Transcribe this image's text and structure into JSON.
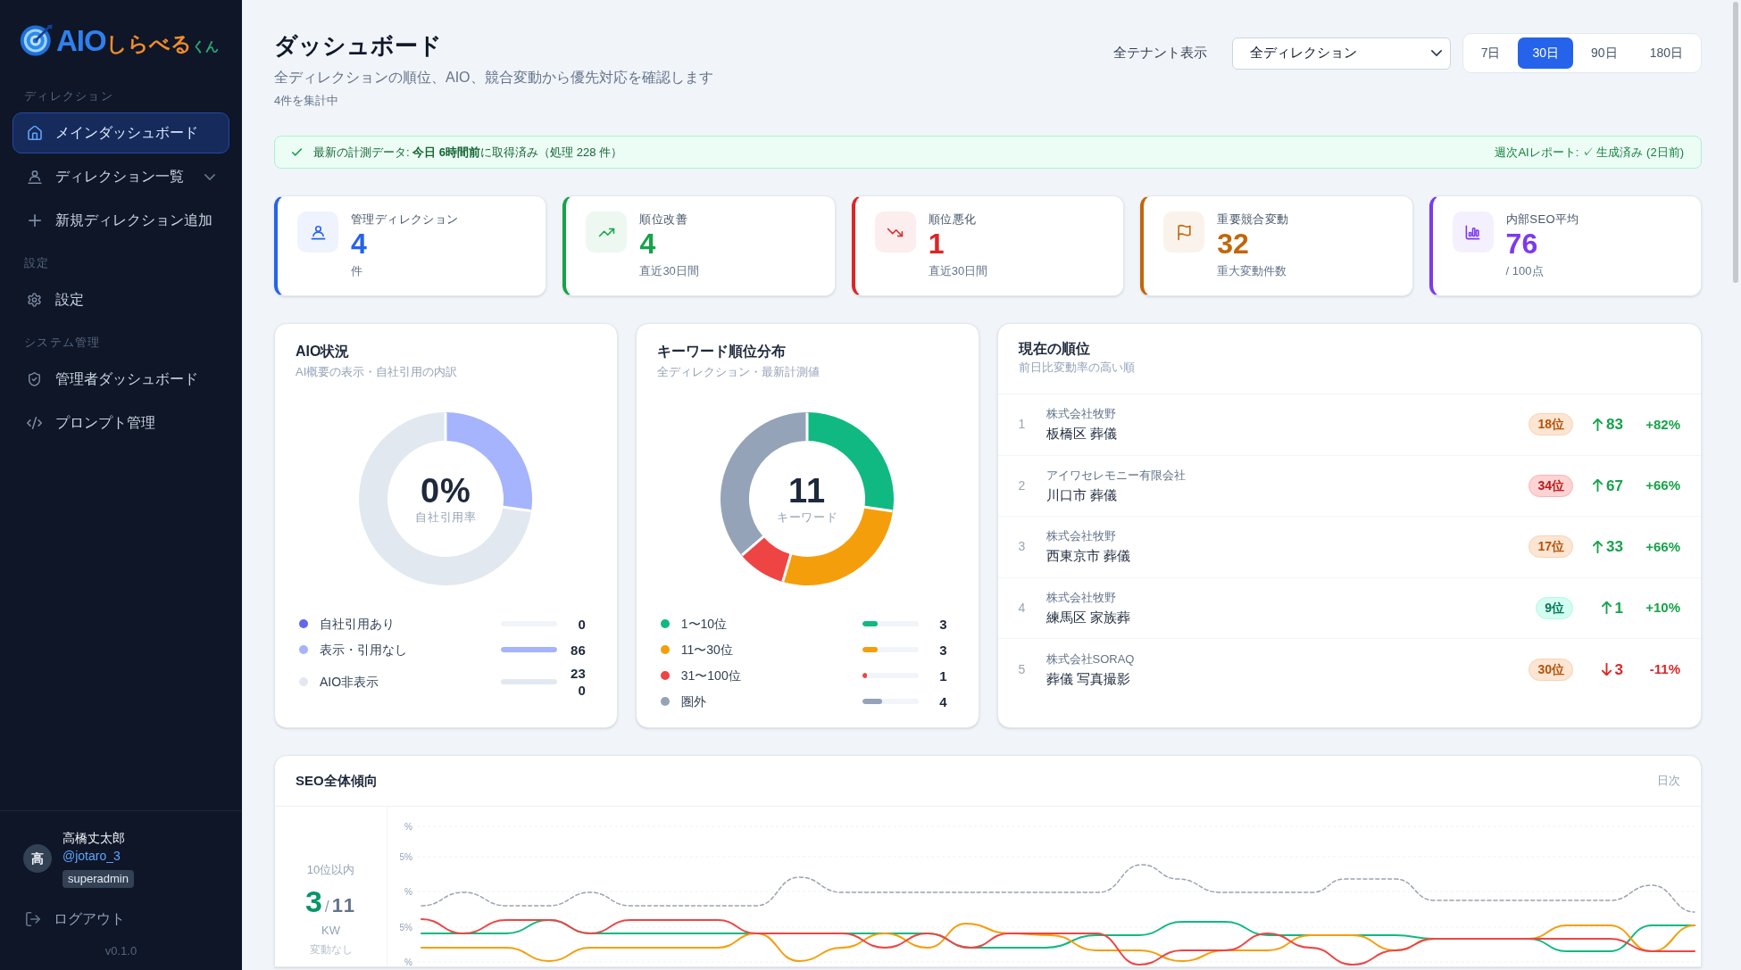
{
  "sidebar": {
    "logo": {
      "brand": "AIO",
      "name": "しらべる",
      "suffix": "くん"
    },
    "sections": [
      {
        "label": "ディレクション",
        "items": [
          {
            "label": "メインダッシュボード",
            "selected": true
          },
          {
            "label": "ディレクション一覧",
            "selected": false,
            "expanded": false
          },
          {
            "label": "新規ディレクション追加",
            "selected": false
          }
        ]
      },
      {
        "label": "設定",
        "items": [
          {
            "label": "設定",
            "selected": false
          }
        ]
      },
      {
        "label": "システム管理",
        "items": [
          {
            "label": "管理者ダッシュボード",
            "selected": false
          },
          {
            "label": "プロンプト管理",
            "selected": false
          }
        ]
      }
    ],
    "user": {
      "avatar": "高",
      "name": "高橋丈太郎",
      "handle": "@jotaro_3",
      "role": "superadmin"
    },
    "logout": "ログアウト",
    "version": "v0.1.0"
  },
  "header": {
    "title": "ダッシュボード",
    "subtitle": "全ディレクションの順位、AIO、競合変動から優先対応を確認します",
    "count_note": "4件を集計中",
    "tenant_toggle": "全テナント表示",
    "direction_select": {
      "value": "全ディレクション"
    },
    "periods": [
      {
        "label": "7日",
        "selected": false
      },
      {
        "label": "30日",
        "selected": true
      },
      {
        "label": "90日",
        "selected": false
      },
      {
        "label": "180日",
        "selected": false
      }
    ]
  },
  "status_banner": {
    "data_status": "最新の計測データ: **今日 6時間前**に取得済み（処理 228 件）",
    "report_status": "週次AIレポート: ✓ 生成済み (2日前)"
  },
  "stats": [
    {
      "label": "管理ディレクション",
      "value": "4",
      "note": "件",
      "color": "#2563eb"
    },
    {
      "label": "順位改善",
      "value": "4",
      "note": "直近30日間",
      "color": "#16a34a"
    },
    {
      "label": "順位悪化",
      "value": "1",
      "note": "直近30日間",
      "color": "#dc2626"
    },
    {
      "label": "重要競合変動",
      "value": "32",
      "note": "重大変動件数",
      "color": "#c2660a"
    },
    {
      "label": "内部SEO平均",
      "value": "76",
      "note": "/ 100点",
      "color": "#7c3aed"
    }
  ],
  "aio_status": {
    "title": "AIO状況",
    "subtitle": "AI概要の表示・自社引用の内訳",
    "center_value": "0%",
    "center_label": "自社引用率",
    "chart_data": {
      "type": "donut",
      "categories": [
        "自社引用あり",
        "表示・引用なし",
        "AIO非表示"
      ],
      "values": [
        0,
        27.22,
        72.78
      ],
      "legend": "bottom"
    },
    "legend": [
      {
        "count": "0",
        "color": "#6366f1",
        "level": 0
      },
      {
        "count": "86",
        "color": "#a5b4fc",
        "level": 1
      },
      {
        "count": "230",
        "color": "#e2e8f0",
        "level": 1
      }
    ]
  },
  "keyword_distribution": {
    "title": "キーワード順位分布",
    "subtitle": "全ディレクション・最新計測値",
    "center_value": "11",
    "center_label": "キーワード",
    "chart_data": {
      "type": "donut",
      "categories": [
        "1〜10位",
        "11〜30位",
        "31〜100位",
        "圏外"
      ],
      "values": [
        27.27,
        27.27,
        9.09,
        36.37
      ],
      "legend": "bottom"
    },
    "legend": [
      {
        "count": "3",
        "color": "#10b981",
        "level": 0.27
      },
      {
        "count": "3",
        "color": "#f59e0b",
        "level": 0.27
      },
      {
        "count": "1",
        "color": "#ef4444",
        "level": 0.09
      },
      {
        "count": "4",
        "color": "#94a3b8",
        "level": 0.36
      }
    ]
  },
  "ranking": {
    "title": "現在の順位",
    "subtitle": "前日比変動率の高い順",
    "rows": [
      {
        "number": "1",
        "company": "株式会社牧野",
        "keyword": "板橋区 葬儀",
        "rank": "18位",
        "color": "#b45309",
        "rising": true,
        "change": "83",
        "rate": "+82%"
      },
      {
        "number": "2",
        "company": "アイワセレモニー有限会社",
        "keyword": "川口市 葬儀",
        "rank": "34位",
        "color": "#b91c1c",
        "rising": true,
        "change": "67",
        "rate": "+66%"
      },
      {
        "number": "3",
        "company": "株式会社牧野",
        "keyword": "西東京市 葬儀",
        "rank": "17位",
        "color": "#b45309",
        "rising": true,
        "change": "33",
        "rate": "+66%"
      },
      {
        "number": "4",
        "company": "株式会社牧野",
        "keyword": "練馬区 家族葬",
        "rank": "9位",
        "color": "#047857",
        "rising": true,
        "change": "1",
        "rate": "+10%"
      },
      {
        "number": "5",
        "company": "株式会社SORAQ",
        "keyword": "葬儀 写真撮影",
        "rank": "30位",
        "color": "#b45309",
        "rising": false,
        "change": "3",
        "rate": "-11%"
      }
    ]
  },
  "seo_trend": {
    "title": "SEO全体傾向",
    "interval": "日次",
    "summary": {
      "label": "10位以内",
      "value": "3",
      "separator": "/",
      "total": "11",
      "unit": "KW",
      "note": "変動なし"
    },
    "y_axis_labels": [
      "%",
      "5%",
      "%",
      "5%",
      "%"
    ]
  }
}
